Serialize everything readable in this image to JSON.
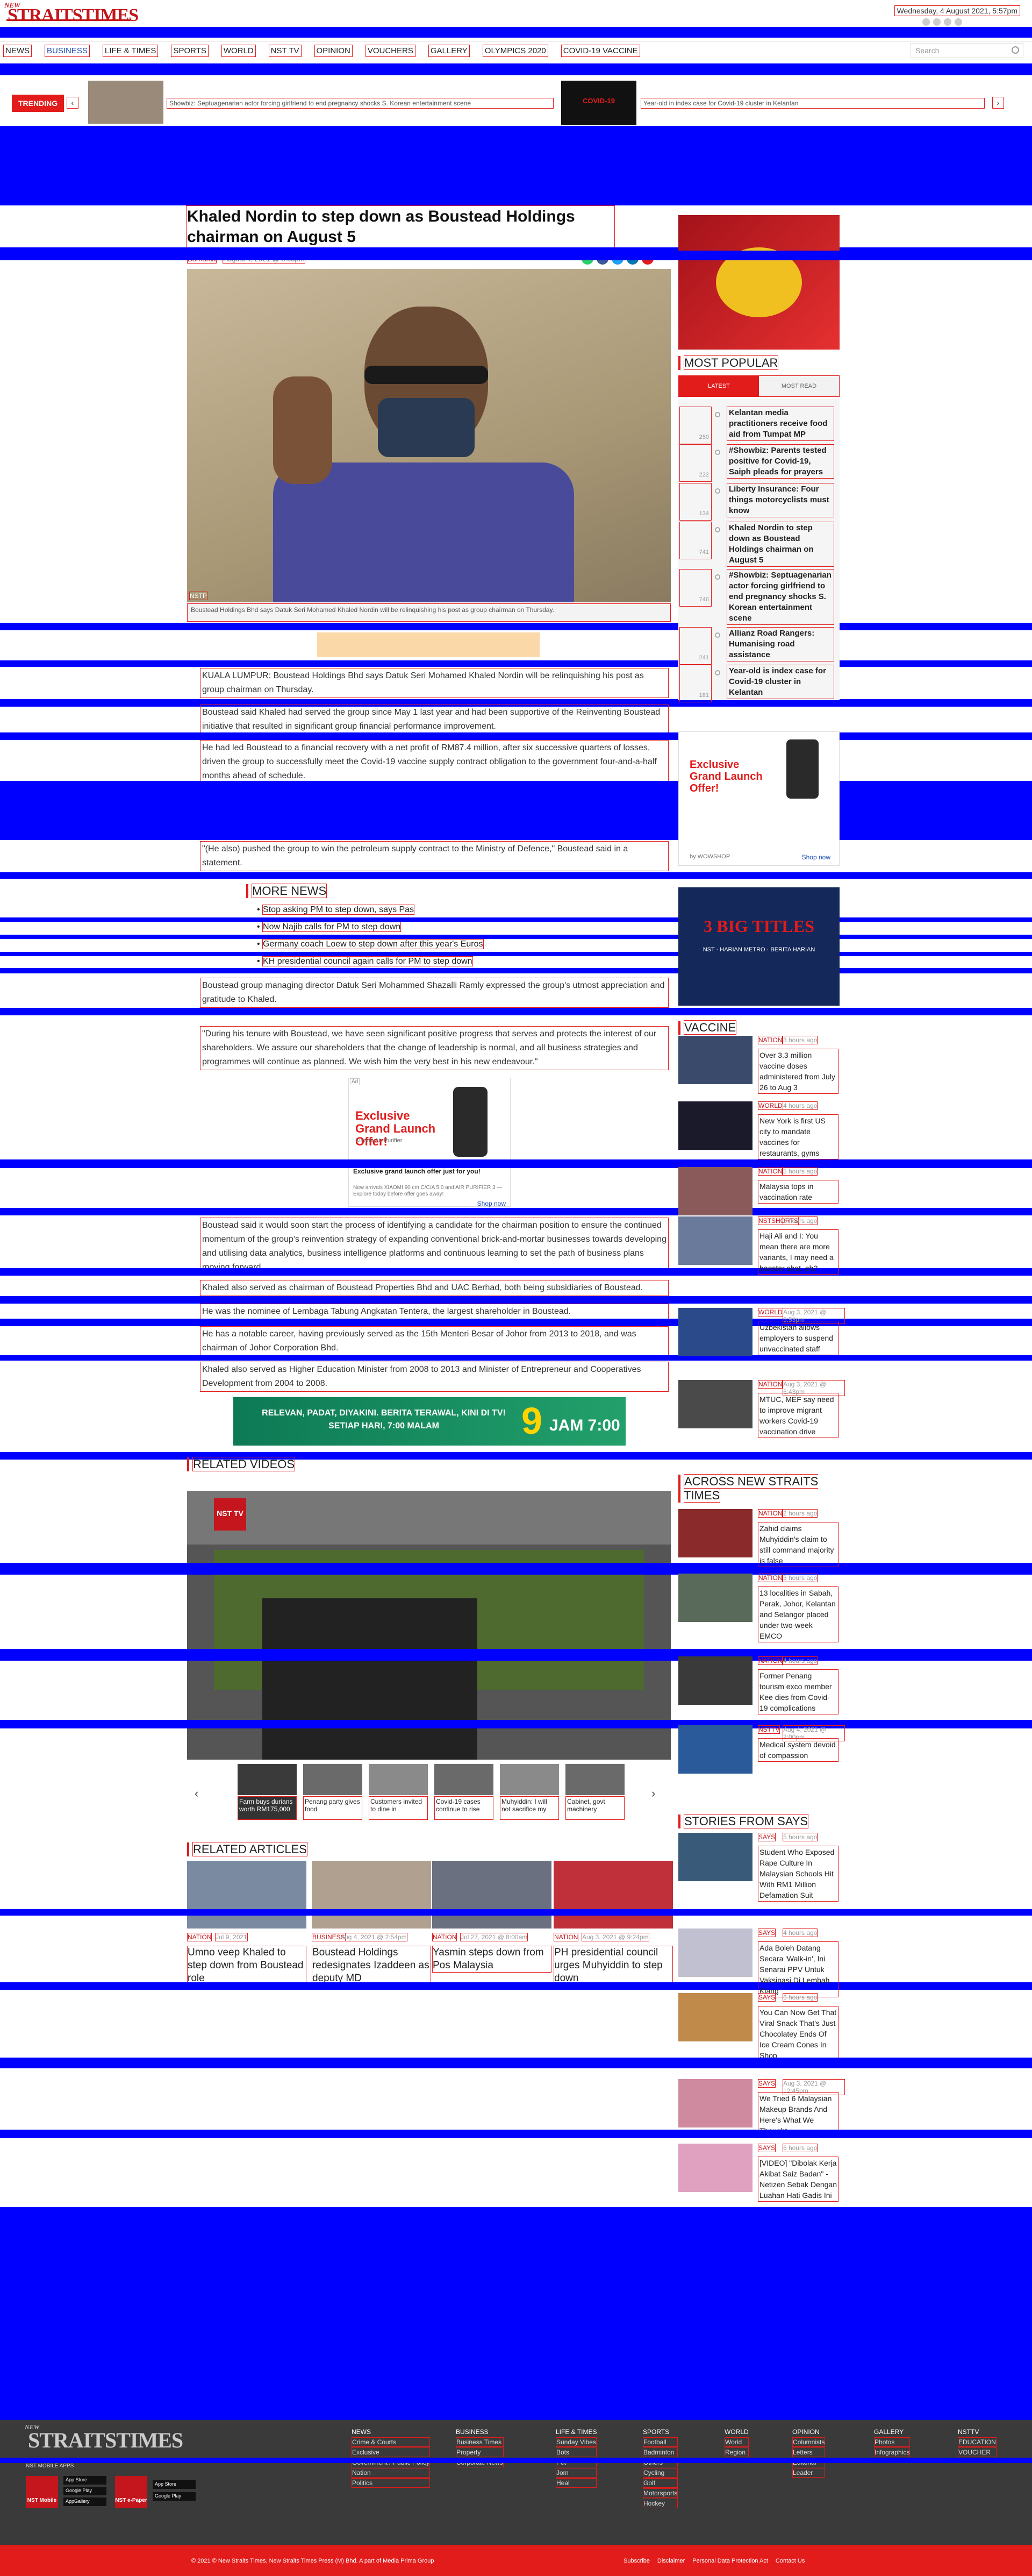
{
  "header": {
    "logo_small": "NEW",
    "logo_main": "STRAITSTIMES",
    "date": "Wednesday, 4 August 2021, 5:57pm"
  },
  "nav": {
    "items": [
      "NEWS",
      "BUSINESS",
      "LIFE & TIMES",
      "SPORTS",
      "WORLD",
      "NST TV",
      "OPINION",
      "VOUCHERS",
      "GALLERY",
      "OLYMPICS 2020",
      "COVID-19 VACCINE"
    ],
    "search_placeholder": "Search"
  },
  "trending": {
    "tag": "TRENDING",
    "item1": "Showbiz: Septuagenarian actor forcing girlfriend to end pregnancy shocks S. Korean entertainment scene",
    "item2": "Year-old in index case for Covid-19 cluster in Kelantan",
    "promo_label": "COVID-19"
  },
  "article": {
    "headline": "Khaled Nordin to step down as Boustead Holdings chairman on August 5",
    "author": "Bernama",
    "date": "August 4, 2021 @ 8:05pm",
    "photo_caption": "Boustead Holdings Bhd says Datuk Seri Mohamed Khaled Nordin will be relinquishing his post as group chairman on Thursday.",
    "photo_credit": "NSTP",
    "paragraphs": [
      "KUALA LUMPUR: Boustead Holdings Bhd says Datuk Seri Mohamed Khaled Nordin will be relinquishing his post as group chairman on Thursday.",
      "Boustead said Khaled had served the group since May 1 last year and had been supportive of the Reinventing Boustead initiative that resulted in significant group financial performance improvement.",
      "He had led Boustead to a financial recovery with a net profit of RM87.4 million, after six successive quarters of losses, driven the group to successfully meet the Covid-19 vaccine supply contract obligation to the government four-and-a-half months ahead of schedule.",
      "\"(He also) pushed the group to win the petroleum supply contract to the Ministry of Defence,\" Boustead said in a statement.",
      "Boustead group managing director Datuk Seri Mohammed Shazalli Ramly expressed the group's utmost appreciation and gratitude to Khaled.",
      "\"During his tenure with Boustead, we have seen significant positive progress that serves and protects the interest of our shareholders. We assure our shareholders that the change of leadership is normal, and all business strategies and programmes will continue as planned. We wish him the very best in his new endeavour.\"",
      "Boustead said it would soon start the process of identifying a candidate for the chairman position to ensure the continued momentum of the group's reinvention strategy of expanding conventional brick-and-mortar businesses towards developing and utilising data analytics, business intelligence platforms and continuous learning to set the path of business plans moving forward.",
      "Khaled also served as chairman of Boustead Properties Bhd and UAC Berhad, both being subsidiaries of Boustead.",
      "He was the nominee of Lembaga Tabung Angkatan Tentera, the largest shareholder in Boustead.",
      "He has a notable career, having previously served as the 15th Menteri Besar of Johor from 2013 to 2018, and was chairman of Johor Corporation Bhd.",
      "Khaled also served as Higher Education Minister from 2008 to 2013 and Minister of Entrepreneur and Cooperatives Development from 2004 to 2008."
    ]
  },
  "more_news": {
    "title": "MORE NEWS",
    "items": [
      "Stop asking PM to step down, says Pas",
      "Now Najib calls for PM to step down",
      "Germany coach Loew to step down after this year's Euros",
      "KH presidential council again calls for PM to step down"
    ]
  },
  "ads": {
    "ad_label": "Ad",
    "promo_title": "Exclusive Grand Launch Offer!",
    "promo_sub": "Xiaomi Air Purifier",
    "promo_line": "Exclusive grand launch offer just for you!",
    "promo_desc": "New arrivals XIAOMI 90 cm C/C/A 5.0 and AIR PURIFIER 3 — Explore today before offer goes away!",
    "shop_now": "Shop now",
    "shop_brand": "by WOWSHOP",
    "banner_text": "RELEVAN, PADAT, DIYAKINI. BERITA TERAWAL, KINI DI TV! SETIAP HARI, 7:00 MALAM",
    "banner_channel": "9",
    "banner_time": "JAM 7:00",
    "side_ad_title": "3 BIG TITLES",
    "side_ad_sub": "NST · HARIAN METRO · BERITA HARIAN"
  },
  "most_popular": {
    "title": "MOST POPULAR",
    "tabs": [
      "LATEST",
      "MOST READ"
    ],
    "items": [
      {
        "num": "250",
        "title": "Kelantan media practitioners receive food aid from Tumpat MP"
      },
      {
        "num": "222",
        "title": "#Showbiz: Parents tested positive for Covid-19, Saiph pleads for prayers"
      },
      {
        "num": "134",
        "title": "Liberty Insurance: Four things motorcyclists must know"
      },
      {
        "num": "741",
        "title": "Khaled Nordin to step down as Boustead Holdings chairman on August 5"
      },
      {
        "num": "746",
        "title": "#Showbiz: Septuagenarian actor forcing girlfriend to end pregnancy shocks S. Korean entertainment scene"
      },
      {
        "num": "241",
        "title": "Allianz Road Rangers: Humanising road assistance"
      },
      {
        "num": "181",
        "title": "Year-old is index case for Covid-19 cluster in Kelantan"
      }
    ]
  },
  "vaccine": {
    "title": "VACCINE",
    "items": [
      {
        "cat": "NATION",
        "time": "3 hours ago",
        "title": "Over 3.3 million vaccine doses administered from July 26 to Aug 3"
      },
      {
        "cat": "WORLD",
        "time": "4 hours ago",
        "title": "New York is first US city to mandate vaccines for restaurants, gyms"
      },
      {
        "cat": "NATION",
        "time": "5 hours ago",
        "title": "Malaysia tops in vaccination rate"
      },
      {
        "cat": "NSTSHORTS",
        "time": "2 hours ago",
        "title": "Haji Ali and I: You mean there are more variants, I may need a booster shot, eh?"
      },
      {
        "cat": "WORLD",
        "time": "Aug 3, 2021 @ 9:53pm",
        "title": "Uzbekistan allows employers to suspend unvaccinated staff"
      },
      {
        "cat": "NATION",
        "time": "Aug 3, 2021 @ 6:43pm",
        "title": "MTUC, MEF say need to improve migrant workers Covid-19 vaccination drive"
      }
    ]
  },
  "across": {
    "title": "ACROSS NEW STRAITS TIMES",
    "items": [
      {
        "cat": "NATION",
        "time": "2 hours ago",
        "title": "Zahid claims Muhyiddin's claim to still command majority is false"
      },
      {
        "cat": "NATION",
        "time": "3 hours ago",
        "title": "13 localities in Sabah, Perak, Johor, Kelantan and Selangor placed under two-week EMCO"
      },
      {
        "cat": "NATION",
        "time": "4 hours ago",
        "title": "Former Penang tourism exco member Kee dies from Covid-19 complications"
      },
      {
        "cat": "NSTTV",
        "time": "Aug 4, 2021 @ 2:00pm",
        "title": "Medical system devoid of compassion"
      }
    ]
  },
  "says": {
    "title": "STORIES FROM SAYS",
    "items": [
      {
        "cat": "SAYS",
        "time": "5 hours ago",
        "title": "Student Who Exposed Rape Culture In Malaysian Schools Hit With RM1 Million Defamation Suit"
      },
      {
        "cat": "SAYS",
        "time": "4 hours ago",
        "title": "Ada Boleh Datang Secara 'Walk-in', Ini Senarai PPV Untuk Vaksinasi Di Lembah Klang"
      },
      {
        "cat": "SAYS",
        "time": "6 hours ago",
        "title": "You Can Now Get That Viral Snack That's Just Chocolatey Ends Of Ice Cream Cones In Shop"
      },
      {
        "cat": "SAYS",
        "time": "Aug 3, 2021 @ 12:45pm",
        "title": "We Tried 6 Malaysian Makeup Brands And Here's What We Thought"
      },
      {
        "cat": "SAYS",
        "time": "6 hours ago",
        "title": "[VIDEO] \"Dibolak Kerja Akibat Saiz Badan\" - Netizen Sebak Dengan Luahan Hati Gadis Ini"
      }
    ]
  },
  "videos": {
    "title": "RELATED VIDEOS",
    "player_logo": "NST TV",
    "thumbs": [
      "Farm buys durians worth RM175,000",
      "Penang party gives food",
      "Customers invited to dine in",
      "Covid-19 cases continue to rise",
      "Muhyiddin: I will not sacrifice my",
      "Cabinet, govt machinery"
    ]
  },
  "related": {
    "title": "RELATED ARTICLES",
    "items": [
      {
        "cat": "NATION",
        "time": "Jul 9, 2021",
        "title": "Umno veep Khaled to step down from Boustead role"
      },
      {
        "cat": "BUSINESS",
        "time": "Aug 4, 2021 @ 2:54pm",
        "title": "Boustead Holdings redesignates Izaddeen as deputy MD"
      },
      {
        "cat": "NATION",
        "time": "Jul 27, 2021 @ 8:00am",
        "title": "Yasmin steps down from Pos Malaysia"
      },
      {
        "cat": "NATION",
        "time": "Aug 3, 2021 @ 9:24pm",
        "title": "PH presidential council urges Muhyiddin to step down"
      }
    ]
  },
  "footer": {
    "logo_small": "NEW",
    "logo_main": "STRAITSTIMES",
    "apps_label": "NST MOBILE APPS",
    "app1": "NST Mobile",
    "app2": "NST e-Paper",
    "store1": "App Store",
    "store2": "Google Play",
    "store3": "AppGallery",
    "columns": [
      {
        "head": "NEWS",
        "links": [
          "Crime & Courts",
          "Exclusive",
          "Government / Public Policy",
          "Nation",
          "Politics"
        ]
      },
      {
        "head": "BUSINESS",
        "links": [
          "Business Times",
          "Property",
          "Corporate News"
        ]
      },
      {
        "head": "LIFE & TIMES",
        "links": [
          "Sunday Vibes",
          "Bots",
          "Pet",
          "Jom",
          "Heal"
        ]
      },
      {
        "head": "SPORTS",
        "links": [
          "Football",
          "Badminton",
          "Others",
          "Cycling",
          "Golf",
          "Motorsports",
          "Hockey"
        ]
      },
      {
        "head": "WORLD",
        "links": [
          "World",
          "Region"
        ]
      },
      {
        "head": "OPINION",
        "links": [
          "Columnists",
          "Letters",
          "Editorial",
          "Leader"
        ]
      },
      {
        "head": "GALLERY",
        "links": [
          "Photos",
          "Infographics"
        ]
      },
      {
        "head": "NSTTV",
        "links": [
          "EDUCATION",
          "VOUCHER"
        ]
      }
    ],
    "copyright": "© 2021 © New Straits Times, New Straits Times Press (M) Bhd. A part of Media Prima Group",
    "links": [
      "Subscribe",
      "Disclaimer",
      "Personal Data Protection Act",
      "Contact Us"
    ]
  },
  "colors": {
    "brand_red": "#c4161c",
    "band": "#0000ff",
    "accent_blue": "#1f4fb4"
  }
}
